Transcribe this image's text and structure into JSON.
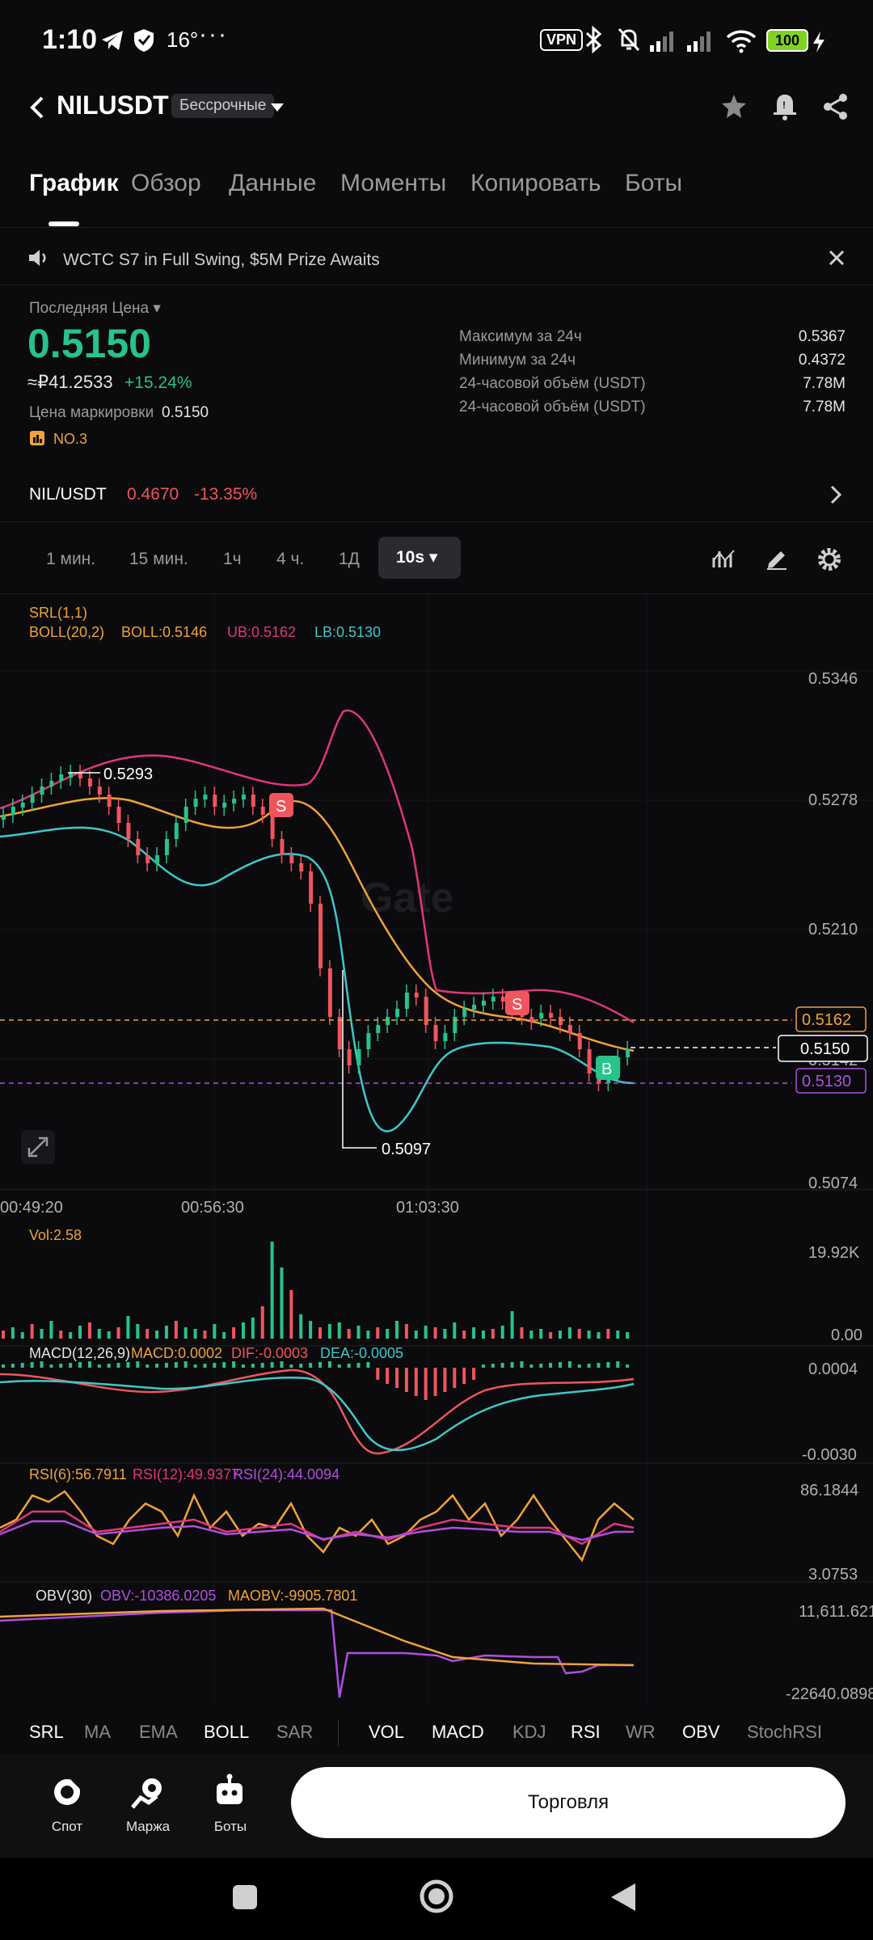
{
  "status": {
    "time": "1:10",
    "temp": "16°",
    "dots": "···",
    "vpn": "VPN",
    "battery": "100"
  },
  "header": {
    "symbol": "NILUSDT",
    "contract_type": "Бессрочные"
  },
  "tabs": [
    "График",
    "Обзор",
    "Данные",
    "Моменты",
    "Копировать",
    "Боты"
  ],
  "banner": {
    "text": "WCTC S7 in Full Swing, $5M Prize Awaits"
  },
  "ticker": {
    "last_price_label": "Последняя Цена",
    "last_price": "0.5150",
    "rub_price": "≈₽41.2533",
    "change_pct": "+15.24%",
    "mark_label": "Цена маркировки",
    "mark_price": "0.5150",
    "rank": "NO.3",
    "stats": [
      {
        "label": "Максимум за 24ч",
        "value": "0.5367"
      },
      {
        "label": "Минимум за 24ч",
        "value": "0.4372"
      },
      {
        "label": "24-часовой объём (USDT)",
        "value": "7.78M"
      },
      {
        "label": "24-часовой объём (USDT)",
        "value": "7.78M"
      }
    ]
  },
  "pair": {
    "name": "NIL/USDT",
    "price": "0.4670",
    "change": "-13.35%"
  },
  "timeframes": [
    "1 мин.",
    "15 мин.",
    "1ч",
    "4 ч.",
    "1Д"
  ],
  "timeframe_selected": "10s",
  "chart_data": {
    "type": "line",
    "indicators": {
      "srl": "SRL(1,1)",
      "boll": "BOLL(20,2)",
      "boll_value": "BOLL:0.5146",
      "ub": "UB:0.5162",
      "lb": "LB:0.5130"
    },
    "price_axis": [
      "0.5346",
      "0.5278",
      "0.5210",
      "0.5142",
      "0.5074"
    ],
    "time_axis": [
      "00:49:20",
      "00:56:30",
      "01:03:30"
    ],
    "annotations": {
      "high": "0.5293",
      "low": "0.5097",
      "sell": "S",
      "buy": "B"
    },
    "price_tags": {
      "ub": "0.5162",
      "last": "0.5150",
      "lb": "0.5130"
    },
    "colors": {
      "up": "#27c38a",
      "down": "#f0555d",
      "boll": "#f0a23b",
      "ub": "#e0377a",
      "lb": "#3fc8c8",
      "dif": "#f0555d",
      "dea": "#3fc8c8",
      "rsi6": "#f0a23b",
      "rsi12": "#e0377a",
      "rsi24": "#b04fe0",
      "obv": "#b04fe0",
      "maobv": "#f0a23b"
    },
    "volume": {
      "label": "Vol:2.58",
      "axis": [
        "19.92K",
        "0.00"
      ]
    },
    "macd": {
      "label": "MACD(12,26,9)",
      "macd": "MACD:0.0002",
      "dif": "DIF:-0.0003",
      "dea": "DEA:-0.0005",
      "axis": [
        "0.0004",
        "-0.0030"
      ]
    },
    "rsi": {
      "rsi6": "RSI(6):56.7911",
      "rsi12": "RSI(12):49.9377",
      "rsi24": "RSI(24):44.0094",
      "axis": [
        "86.1844",
        "3.0753"
      ]
    },
    "obv": {
      "label": "OBV(30)",
      "obv": "OBV:-10386.0205",
      "maobv": "MAOBV:-9905.7801",
      "axis": [
        "11,611.6211",
        "-22640.0898"
      ]
    }
  },
  "indicator_tabs": {
    "main": [
      "SRL",
      "MA",
      "EMA",
      "BOLL",
      "SAR"
    ],
    "sub": [
      "VOL",
      "MACD",
      "KDJ",
      "RSI",
      "WR",
      "OBV",
      "StochRSI"
    ]
  },
  "bottom": {
    "spot": "Спот",
    "margin": "Маржа",
    "bots": "Боты",
    "trade": "Торговля"
  }
}
